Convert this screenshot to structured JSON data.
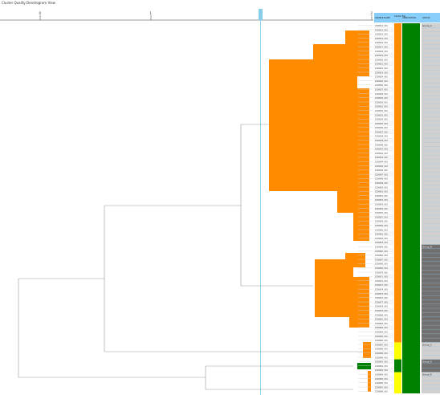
{
  "window": {
    "title": "Cluster Quality Dendrogram View"
  },
  "axis": {
    "ticks": [
      {
        "label": "0"
      },
      {
        "label": "1"
      },
      {
        "label": "2"
      }
    ]
  },
  "columns": [
    {
      "key": "sample",
      "label": "SAMPLE NAME"
    },
    {
      "key": "cluster",
      "label": "Cluster Bar"
    },
    {
      "key": "annotation",
      "label": "ANNOTATION"
    },
    {
      "key": "group",
      "label": "GROUP"
    }
  ],
  "groups": [
    {
      "label": "Group_A",
      "start": 0,
      "end": 52,
      "color": "#d0d0d0"
    },
    {
      "label": "Group_B",
      "start": 52,
      "end": 75,
      "color": "#707070"
    },
    {
      "label": "Group_C",
      "start": 75,
      "end": 79,
      "color": "#d0d0d0"
    },
    {
      "label": "Group_D",
      "start": 79,
      "end": 82,
      "color": "#707070"
    },
    {
      "label": "Group_E",
      "start": 82,
      "end": 87,
      "color": "#d0d0d0"
    }
  ],
  "clusters": [
    {
      "name": "orange",
      "color": "#ff8c00",
      "start": 0,
      "end": 75
    },
    {
      "name": "yellow",
      "color": "#ffff00",
      "start": 75,
      "end": 79
    },
    {
      "name": "green",
      "color": "#008000",
      "start": 79,
      "end": 82
    },
    {
      "name": "yellow",
      "color": "#ffff00",
      "start": 82,
      "end": 87
    }
  ],
  "rows": [
    "ZC00012_001",
    "ZC00013_001",
    "ZC00014_001",
    "ZC00015_001",
    "ZC00016_001",
    "ZC00017_001",
    "ZC00018_001",
    "ZC00019_001",
    "ZC00020_001",
    "ZC00021_001",
    "ZC00022_001",
    "ZC00023_001",
    "ZC00024_001",
    "ZC00025_001",
    "ZC00026_001",
    "ZC00027_001",
    "ZC00028_001",
    "ZC00029_001",
    "ZC00030_001",
    "ZC00031_001",
    "ZC00032_001",
    "ZC00033_001",
    "ZC00034_001",
    "ZC00035_001",
    "ZC00036_001",
    "ZC00037_001",
    "ZC00038_001",
    "ZC00039_001",
    "ZC00040_001",
    "ZC00041_001",
    "ZC00042_001",
    "ZC00043_001",
    "ZC00044_001",
    "ZC00045_001",
    "ZC00046_001",
    "ZC00047_001",
    "ZC00048_001",
    "ZC00049_001",
    "ZC00050_001",
    "ZC00051_001",
    "ZC00052_001",
    "ZC00053_001",
    "ZC00054_001",
    "ZC00055_001",
    "ZC00056_001",
    "ZC00057_001",
    "ZC00058_001",
    "ZC00059_001",
    "ZC00060_001",
    "ZC00061_001",
    "ZC00062_001",
    "ZC00063_001",
    "ZC00064_001",
    "ZC00065_001",
    "ZC00066_001",
    "ZC00067_001",
    "ZC00068_001",
    "ZC00069_001",
    "ZC00070_001",
    "ZC00071_001",
    "ZC00072_001",
    "ZC00073_001",
    "ZC00074_001",
    "ZC00075_001",
    "ZC00076_001",
    "ZC00077_001",
    "ZC00078_001",
    "ZC00079_001",
    "ZC00080_001",
    "ZC00081_001",
    "ZC00082_001",
    "ZC00083_001",
    "ZC00084_001",
    "ZC00085_001",
    "ZC00086_001",
    "ZC00087_001",
    "ZC00088_001",
    "ZC00089_001",
    "ZC00090_001",
    "ZC00091_001",
    "ZC00092_001",
    "ZC00093_001",
    "ZC00094_001",
    "ZC00095_001",
    "ZC00096_001",
    "ZC00097_001",
    "ZC00098_001"
  ],
  "colors": {
    "orange": "#ff8c00",
    "green": "#008000",
    "yellow": "#ffff00",
    "header": "#87cefa",
    "cutline": "#87ceeb",
    "line": "#999999"
  }
}
